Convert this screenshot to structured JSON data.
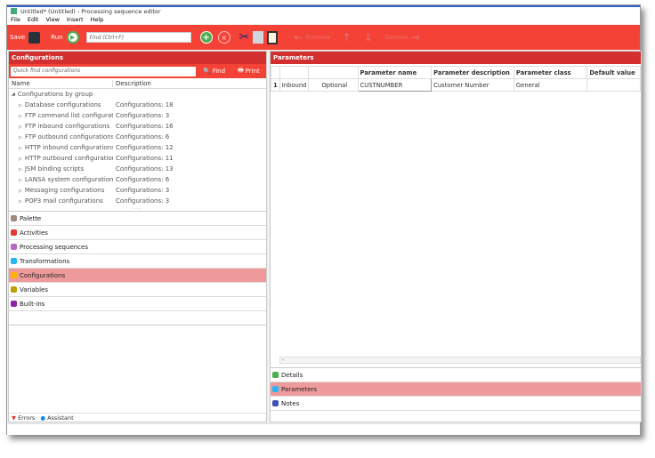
{
  "window": {
    "title": "Untitled* (Untitled) - Processing sequence editor"
  },
  "menu": [
    "File",
    "Edit",
    "View",
    "Insert",
    "Help"
  ],
  "toolbar": {
    "save": "Save",
    "run": "Run",
    "find_placeholder": "Find (Ctrl+F)",
    "promote": "Promote",
    "demote": "Demote"
  },
  "left": {
    "header": "Configurations",
    "quick_find_placeholder": "Quick find configurations",
    "find": "Find",
    "print": "Print",
    "columns": [
      "Name",
      "Description"
    ],
    "group": "Configurations by group",
    "rows": [
      {
        "name": "Database configurations",
        "desc": "Configurations: 18"
      },
      {
        "name": "FTP command list configuratio...",
        "desc": "Configurations: 3"
      },
      {
        "name": "FTP inbound configurations",
        "desc": "Configurations: 16"
      },
      {
        "name": "FTP outbound configurations",
        "desc": "Configurations: 6"
      },
      {
        "name": "HTTP inbound configurations",
        "desc": "Configurations: 12"
      },
      {
        "name": "HTTP outbound configurations",
        "desc": "Configurations: 11"
      },
      {
        "name": "JSM binding scripts",
        "desc": "Configurations: 13"
      },
      {
        "name": "LANSA system configurations",
        "desc": "Configurations: 6"
      },
      {
        "name": "Messaging configurations",
        "desc": "Configurations: 3"
      },
      {
        "name": "POP3 mail configurations",
        "desc": "Configurations: 3"
      }
    ],
    "nav": [
      "Palette",
      "Activities",
      "Processing sequences",
      "Transformations",
      "Configurations",
      "Variables",
      "Built-ins"
    ],
    "tabs": [
      "Errors",
      "Assistant"
    ]
  },
  "right": {
    "header": "Parameters",
    "columns": [
      "",
      "",
      "Parameter name",
      "Parameter description",
      "Parameter class",
      "Default value"
    ],
    "row": {
      "num": "1",
      "direction": "Inbound",
      "required": "Optional",
      "name": "CUSTNUMBER",
      "description": "Customer Number",
      "class": "General",
      "default": ""
    },
    "nav": [
      "Details",
      "Parameters",
      "Notes"
    ]
  }
}
